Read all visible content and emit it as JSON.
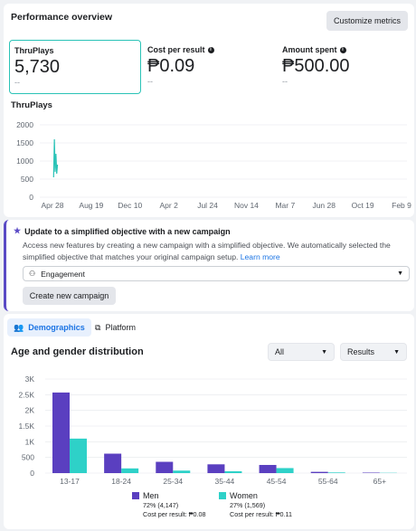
{
  "performance": {
    "title": "Performance overview",
    "customize_label": "Customize metrics",
    "metrics": [
      {
        "label": "ThruPlays",
        "value": "5,730",
        "sub": "--",
        "info": false
      },
      {
        "label": "Cost per result",
        "value": "₱0.09",
        "sub": "--",
        "info": true
      },
      {
        "label": "Amount spent",
        "value": "₱500.00",
        "sub": "--",
        "info": true
      }
    ],
    "chart_title": "ThruPlays"
  },
  "notice": {
    "title": "Update to a simplified objective with a new campaign",
    "body": "Access new features by creating a new campaign with a simplified objective. We automatically selected the simplified objective that matches your original campaign setup.",
    "link": "Learn more",
    "objective_value": "Engagement",
    "create_label": "Create new campaign"
  },
  "demographics": {
    "tabs": [
      {
        "label": "Demographics"
      },
      {
        "label": "Platform"
      }
    ],
    "title": "Age and gender distribution",
    "filter_all": "All",
    "filter_results": "Results",
    "legend": [
      {
        "name": "Men",
        "line1": "72% (4,147)",
        "line2": "Cost per result: ₱0.08",
        "color": "#5a3fc0"
      },
      {
        "name": "Women",
        "line1": "27% (1,569)",
        "line2": "Cost per result: ₱0.11",
        "color": "#2ed1c8"
      }
    ]
  },
  "chart_data": [
    {
      "type": "line",
      "title": "ThruPlays",
      "x_ticks": [
        "Apr 28",
        "Aug 19",
        "Dec 10",
        "Apr 2",
        "Jul 24",
        "Nov 14",
        "Mar 7",
        "Jun 28",
        "Oct 19",
        "Feb 9"
      ],
      "y_ticks": [
        "0",
        "500",
        "1000",
        "1500",
        "2000"
      ],
      "ylim": [
        0,
        2000
      ],
      "series": [
        {
          "values": [
            [
              0.3,
              550
            ],
            [
              0.5,
              1600
            ],
            [
              0.7,
              700
            ],
            [
              0.9,
              1200
            ],
            [
              1.1,
              650
            ],
            [
              1.3,
              900
            ]
          ],
          "color": "#2ac3b7"
        }
      ]
    },
    {
      "type": "bar",
      "title": "Age and gender distribution",
      "categories": [
        "13-17",
        "18-24",
        "25-34",
        "35-44",
        "45-54",
        "55-64",
        "65+"
      ],
      "y_ticks": [
        "0",
        "500",
        "1K",
        "1.5K",
        "2K",
        "2.5K",
        "3K"
      ],
      "ylim": [
        0,
        3000
      ],
      "series": [
        {
          "name": "Men",
          "values": [
            2570,
            620,
            360,
            280,
            260,
            40,
            15
          ],
          "color": "#5a3fc0"
        },
        {
          "name": "Women",
          "values": [
            1100,
            150,
            80,
            60,
            160,
            20,
            8
          ],
          "color": "#2ed1c8"
        }
      ]
    }
  ]
}
